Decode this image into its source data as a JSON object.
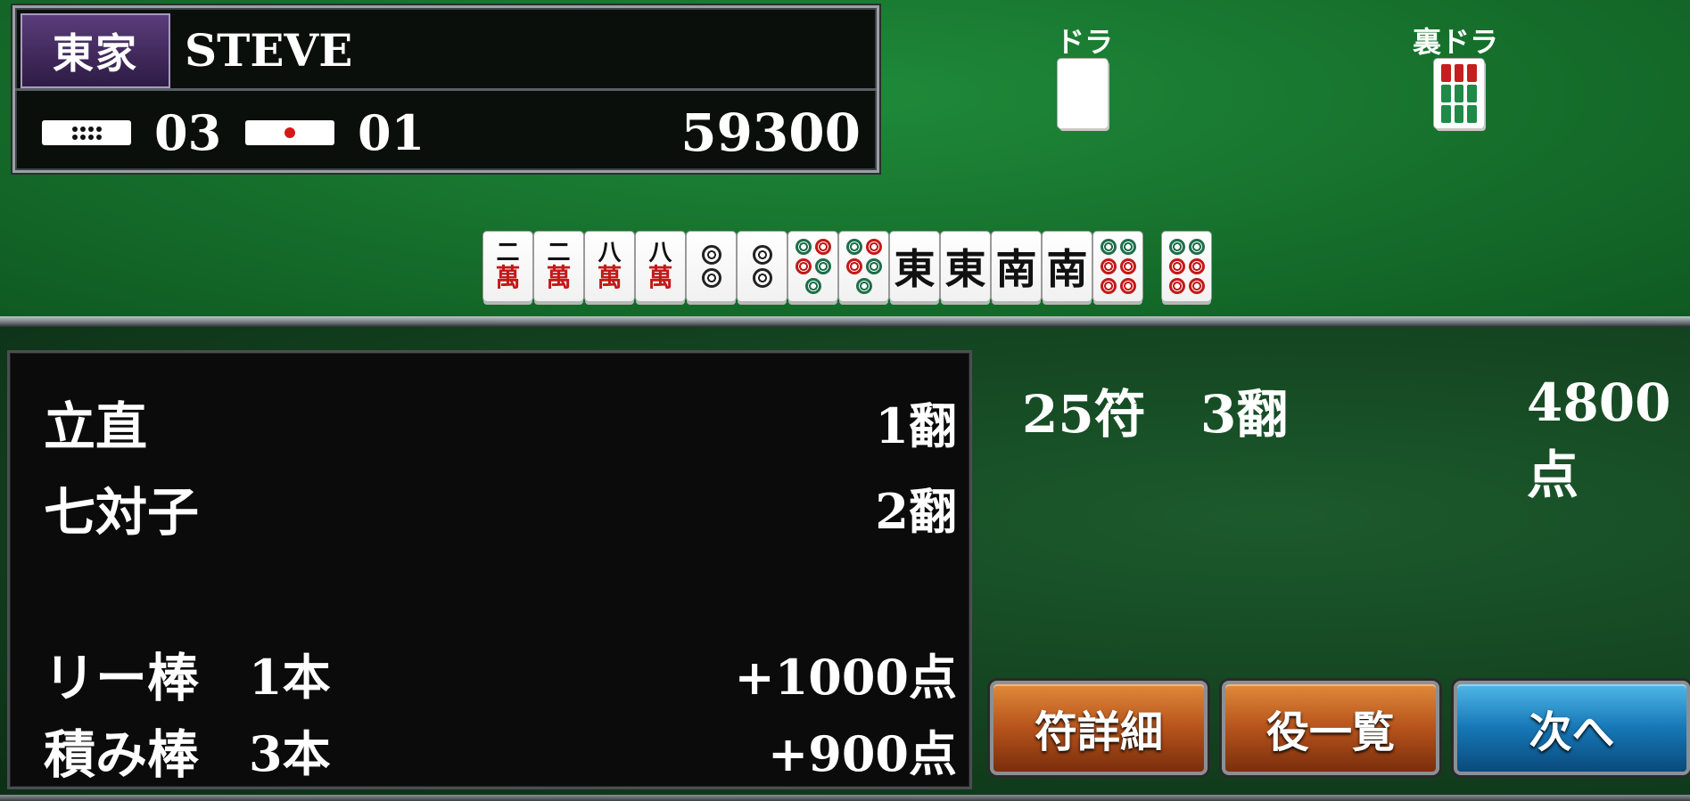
{
  "player": {
    "seat": "東家",
    "name": "STEVE",
    "honba_count": "03",
    "riichi_count": "01",
    "score": "59300"
  },
  "dora": {
    "dora_label": "ドラ",
    "ura_label": "裏ドラ",
    "ura_tile_icon": "sou-8-tile"
  },
  "hand": {
    "tiles": [
      {
        "type": "man",
        "num": "二",
        "suit": "萬",
        "icon": "man-2-tile"
      },
      {
        "type": "man",
        "num": "二",
        "suit": "萬",
        "icon": "man-2-tile"
      },
      {
        "type": "man",
        "num": "八",
        "suit": "萬",
        "icon": "man-8-tile"
      },
      {
        "type": "man",
        "num": "八",
        "suit": "萬",
        "icon": "man-8-tile"
      },
      {
        "type": "pin",
        "icon": "pin-2-tile"
      },
      {
        "type": "pin",
        "icon": "pin-2-tile"
      },
      {
        "type": "pin",
        "icon": "pin-5-tile"
      },
      {
        "type": "pin",
        "icon": "pin-5-tile"
      },
      {
        "type": "honor",
        "char": "東",
        "icon": "east-wind-tile"
      },
      {
        "type": "honor",
        "char": "東",
        "icon": "east-wind-tile"
      },
      {
        "type": "honor",
        "char": "南",
        "icon": "south-wind-tile"
      },
      {
        "type": "honor",
        "char": "南",
        "icon": "south-wind-tile"
      },
      {
        "type": "pin",
        "icon": "pin-6-tile"
      }
    ],
    "winning_tile": {
      "type": "pin",
      "icon": "pin-6-tile"
    }
  },
  "yaku": [
    {
      "name": "立直",
      "value": "1翻"
    },
    {
      "name": "七対子",
      "value": "2翻"
    }
  ],
  "bonuses": [
    {
      "name": "リー棒",
      "count": "1本",
      "value": "+1000点"
    },
    {
      "name": "積み棒",
      "count": "3本",
      "value": "+900点"
    }
  ],
  "summary": {
    "fu": "25符",
    "han": "3翻",
    "points": "4800点"
  },
  "buttons": {
    "fu_detail": "符詳細",
    "yaku_list": "役一覧",
    "next": "次へ"
  },
  "colors": {
    "felt": "#16702c",
    "man_red": "#c41818",
    "button_orange": "#b6531c",
    "button_blue": "#1677b6"
  }
}
